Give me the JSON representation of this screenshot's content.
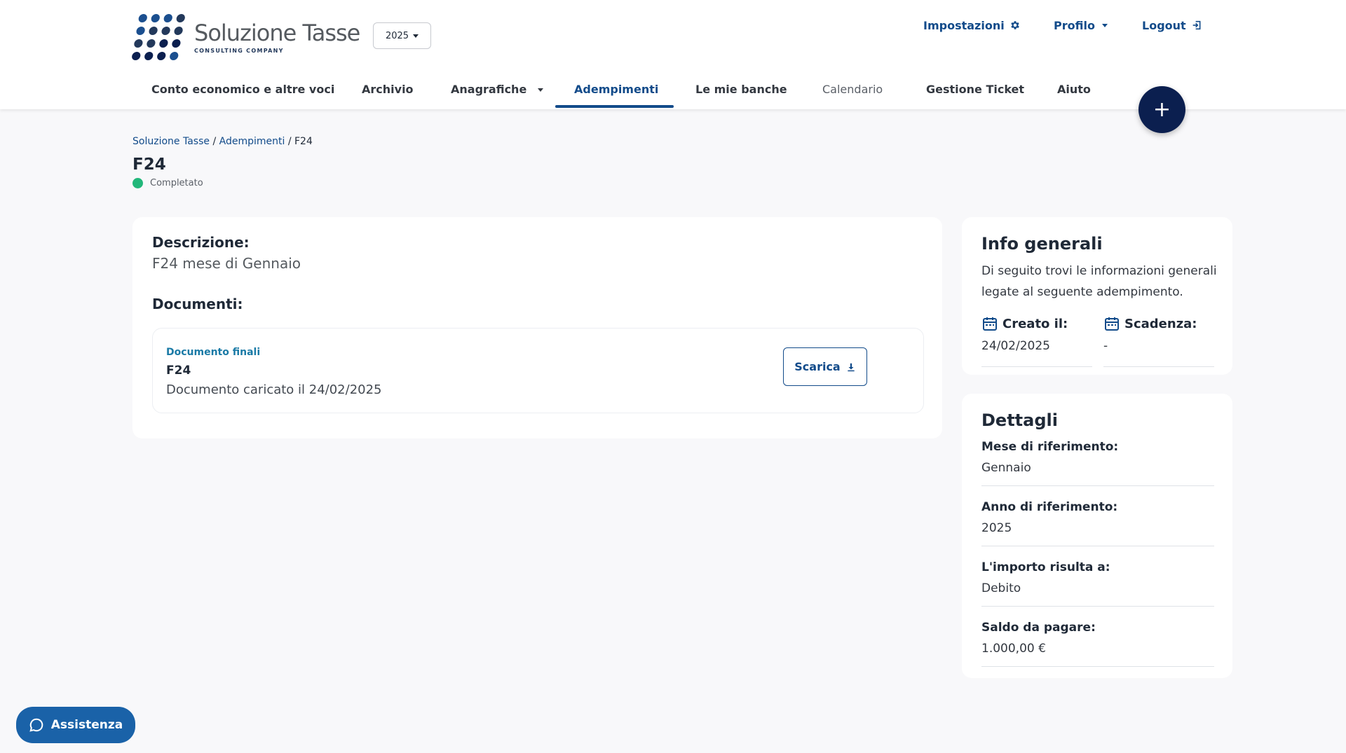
{
  "brand": {
    "name": "Soluzione Tasse",
    "tagline": "CONSULTING COMPANY",
    "logo_colors": [
      "#1b4f8f",
      "#23395b",
      "#0b1f4f"
    ]
  },
  "year_selector": {
    "value": "2025"
  },
  "top_links": {
    "settings": "Impostazioni",
    "profile": "Profilo",
    "logout": "Logout"
  },
  "nav": {
    "items": [
      {
        "label": "Conto economico e altre voci"
      },
      {
        "label": "Archivio"
      },
      {
        "label": "Anagrafiche"
      },
      {
        "label": "Adempimenti"
      },
      {
        "label": "Le mie banche"
      },
      {
        "label": "Calendario"
      },
      {
        "label": "Gestione Ticket"
      },
      {
        "label": "Aiuto"
      }
    ],
    "active": "Adempimenti"
  },
  "fab": {
    "label": "+"
  },
  "breadcrumb": {
    "root": "Soluzione Tasse",
    "section": "Adempimenti",
    "current": "F24",
    "separator": "/"
  },
  "page": {
    "title": "F24",
    "status": "Completato",
    "status_color": "#22b77a"
  },
  "main": {
    "description_label": "Descrizione:",
    "description_value": "F24 mese di Gennaio",
    "documents_label": "Documenti:",
    "documents": [
      {
        "type": "Documento finali",
        "name": "F24",
        "uploaded": "Documento caricato il 24/02/2025",
        "action_label": "Scarica"
      }
    ]
  },
  "info": {
    "title": "Info generali",
    "text": "Di seguito trovi le informazioni generali legate al seguente adempimento.",
    "created_label": "Creato il:",
    "created_value": "24/02/2025",
    "due_label": "Scadenza:",
    "due_value": "-"
  },
  "details": {
    "title": "Dettagli",
    "rows": [
      {
        "label": "Mese di riferimento:",
        "value": "Gennaio"
      },
      {
        "label": "Anno di riferimento:",
        "value": "2025"
      },
      {
        "label": "L'importo risulta a:",
        "value": "Debito"
      },
      {
        "label": "Saldo da pagare:",
        "value": "1.000,00 €"
      }
    ]
  },
  "help": {
    "label": "Assistenza"
  },
  "colors": {
    "primary": "#124b8a",
    "accent": "#1a7aa6",
    "fab": "#0b1f4f",
    "help": "#1a62a8",
    "background": "#f8f8fa"
  }
}
